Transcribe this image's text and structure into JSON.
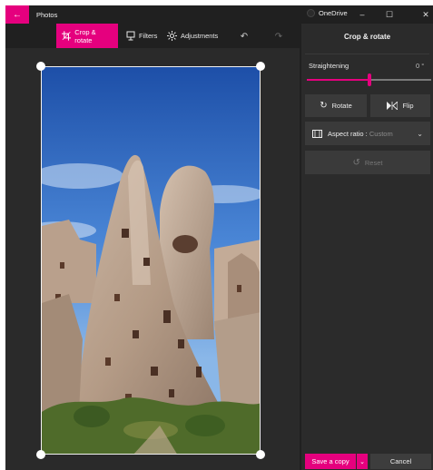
{
  "titlebar": {
    "app_title": "Photos",
    "onedrive_label": "OneDrive",
    "back_icon": "arrow-left-icon",
    "window_controls": [
      "–",
      "☐",
      "✕"
    ]
  },
  "toolbar": {
    "crop_rotate_label": "Crop & rotate",
    "filters_label": "Filters",
    "adjustments_label": "Adjustments",
    "undo_icon": "undo-icon",
    "redo_icon": "redo-icon"
  },
  "panel": {
    "title": "Crop & rotate",
    "straightening_label": "Straightening",
    "straightening_value": "0 °",
    "straightening_level": 0.5,
    "rotate_label": "Rotate",
    "flip_label": "Flip",
    "aspect_label": "Aspect ratio :",
    "aspect_value": "Custom",
    "reset_label": "Reset",
    "save_label": "Save a copy",
    "cancel_label": "Cancel"
  },
  "colors": {
    "accent": "#e5007e",
    "background": "#202020",
    "panel": "#2b2b2b",
    "button": "#3a3a3a"
  }
}
